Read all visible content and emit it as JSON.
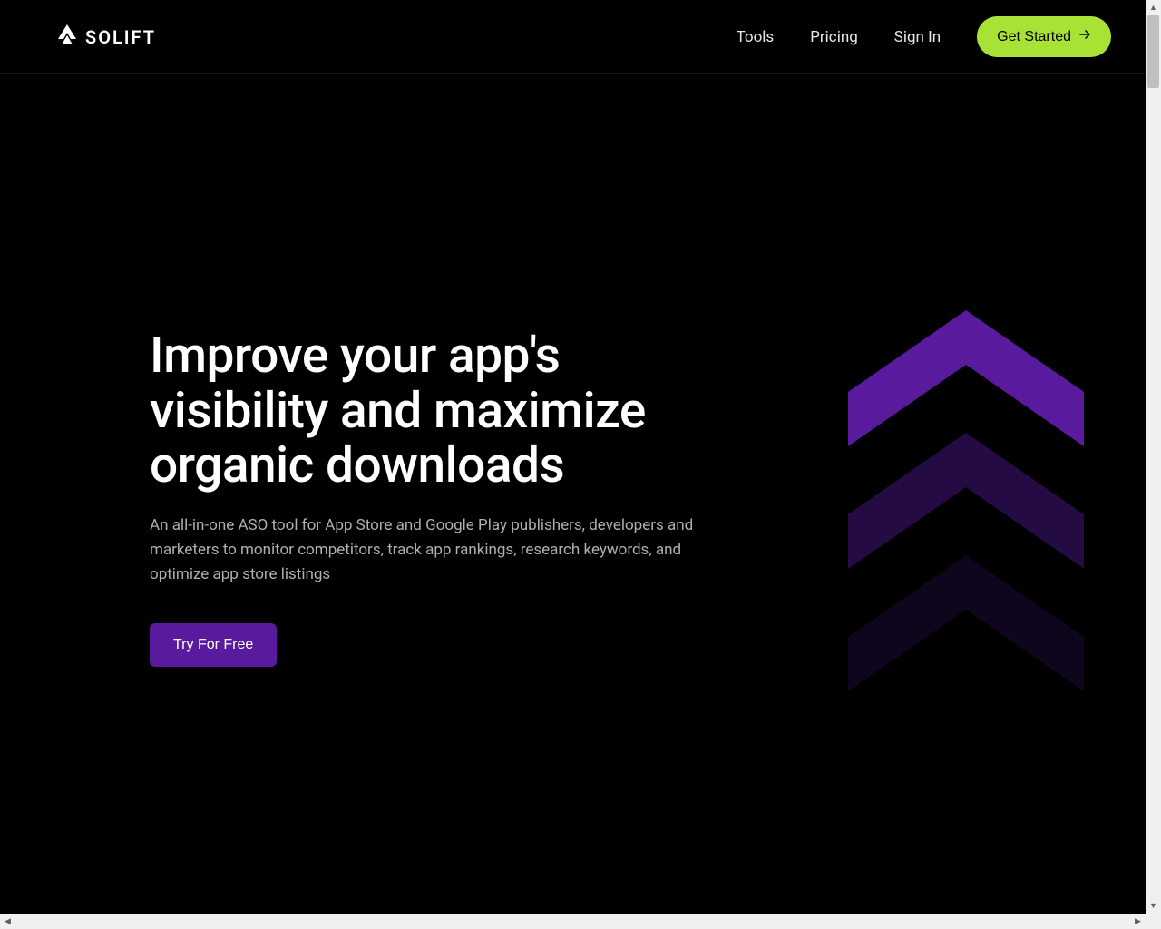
{
  "header": {
    "logo_text": "SOLIFT",
    "nav": {
      "tools": "Tools",
      "pricing": "Pricing",
      "signin": "Sign In",
      "get_started": "Get Started"
    }
  },
  "hero": {
    "title": "Improve your app's visibility and maximize organic downloads",
    "description": "An all-in-one ASO tool for App Store and Google Play publishers, developers and marketers to monitor competitors, track app rankings, research keywords, and optimize app store listings",
    "cta": "Try For Free"
  }
}
